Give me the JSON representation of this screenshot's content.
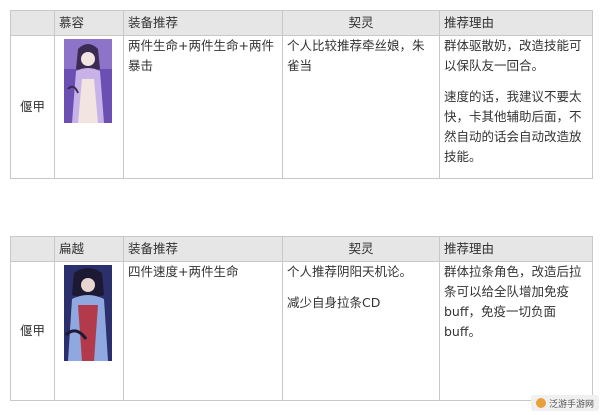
{
  "tables": [
    {
      "headers": [
        "慕容",
        "装备推荐",
        "契灵",
        "推荐理由"
      ],
      "role": "偃甲",
      "equipment": "两件生命+两件生命+两件暴击",
      "qiling": "个人比较推荐牵丝娘，朱雀当",
      "reason_paragraphs": [
        "群体驱散奶，改造技能可以保队友一回合。",
        "速度的话，我建议不要太快，卡其他辅助后面，不然自动的话会自动改造放技能。"
      ],
      "portrait": {
        "name": "muyong-portrait",
        "colors": [
          "#6b4fb3",
          "#c9b2e8",
          "#f2e4e0",
          "#3b2a52"
        ]
      }
    },
    {
      "headers": [
        "扁越",
        "装备推荐",
        "契灵",
        "推荐理由"
      ],
      "role": "偃甲",
      "equipment": "四件速度+两件生命",
      "qiling_paragraphs": [
        "个人推荐阴阳天机论。",
        "减少自身拉条CD"
      ],
      "reason_paragraphs": [
        "群体拉条角色，改造后拉条可以给全队增加免疫buff，免疫一切负面buff。"
      ],
      "portrait": {
        "name": "bianyue-portrait",
        "colors": [
          "#2b2f6b",
          "#b23a4a",
          "#8fa8e0",
          "#1c1a33"
        ]
      }
    }
  ],
  "watermark": "泛游手游网"
}
